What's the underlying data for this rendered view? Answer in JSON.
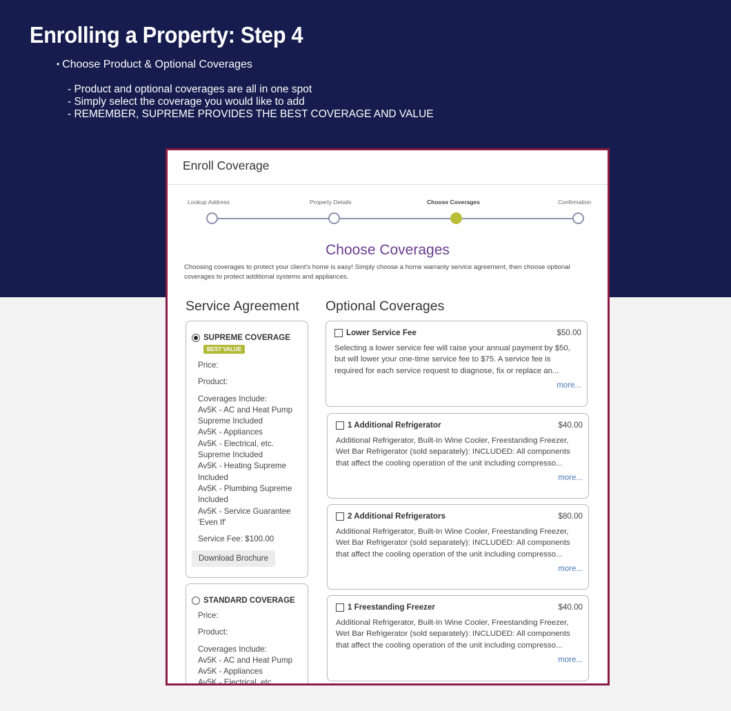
{
  "slide": {
    "title": "Enrolling a Property: Step 4",
    "bullet": "Choose Product & Optional Coverages",
    "sub_points": [
      "- Product and optional coverages are all in one spot",
      "- Simply select the coverage you  would like to add",
      "- REMEMBER, SUPREME PROVIDES THE BEST COVERAGE AND VALUE"
    ]
  },
  "panel": {
    "title": "Enroll Coverage",
    "steps": [
      {
        "label": "Lookup Address",
        "state": "incomplete"
      },
      {
        "label": "Property Details",
        "state": "incomplete"
      },
      {
        "label": "Choose Coverages",
        "state": "active"
      },
      {
        "label": "Confirmation",
        "state": "incomplete"
      }
    ],
    "heading": "Choose Coverages",
    "intro": "Choosing coverages to protect your client's home is easy! Simply choose a home warranty service agreement, then choose optional coverages to protect additional systems and appliances.",
    "service_agreement": {
      "heading": "Service Agreement",
      "plans": [
        {
          "name": "SUPREME COVERAGE",
          "selected": true,
          "badge": "BEST VALUE",
          "price_label": "Price:",
          "product_label": "Product:",
          "coverages_label": "Coverages Include:",
          "coverages": [
            "Av5K - AC and Heat Pump Supreme Included",
            "Av5K - Appliances",
            "Av5K - Electrical, etc. Supreme Included",
            "Av5K - Heating Supreme Included",
            "Av5K - Plumbing Supreme Included",
            "Av5K - Service Guarantee 'Even If'"
          ],
          "service_fee": "Service Fee: $100.00",
          "brochure_label": "Download Brochure"
        },
        {
          "name": "STANDARD COVERAGE",
          "selected": false,
          "price_label": "Price:",
          "product_label": "Product:",
          "coverages_label": "Coverages Include:",
          "coverages": [
            "Av5K - AC and Heat Pump",
            "Av5K - Appliances",
            "Av5K - Electrical, etc."
          ]
        }
      ]
    },
    "optional_coverages": {
      "heading": "Optional Coverages",
      "more_label": "more...",
      "items": [
        {
          "name": "Lower Service Fee",
          "price": "$50.00",
          "checked": false,
          "description": "Selecting a lower service fee will raise your annual payment by $50, but will lower your one-time service fee to $75. A service fee is required for each service request to diagnose, fix or replace an..."
        },
        {
          "name": "1 Additional Refrigerator",
          "price": "$40.00",
          "checked": false,
          "description": "Additional Refrigerator, Built-In Wine Cooler, Freestanding Freezer, Wet Bar Refrigerator (sold separately): INCLUDED: All components that affect the cooling operation of the unit including compresso..."
        },
        {
          "name": "2 Additional Refrigerators",
          "price": "$80.00",
          "checked": false,
          "description": "Additional Refrigerator, Built-In Wine Cooler, Freestanding Freezer, Wet Bar Refrigerator (sold separately): INCLUDED: All components that affect the cooling operation of the unit including compresso..."
        },
        {
          "name": "1 Freestanding Freezer",
          "price": "$40.00",
          "checked": false,
          "description": "Additional Refrigerator, Built-In Wine Cooler, Freestanding Freezer, Wet Bar Refrigerator (sold separately): INCLUDED: All components that affect the cooling operation of the unit including compresso..."
        }
      ]
    }
  },
  "colors": {
    "slide_background": "#161c4e",
    "panel_border": "#8a1c44",
    "heading_purple": "#6a3d8f",
    "active_step": "#b8bf37",
    "badge": "#b3ba3a",
    "link": "#4a78b8"
  }
}
